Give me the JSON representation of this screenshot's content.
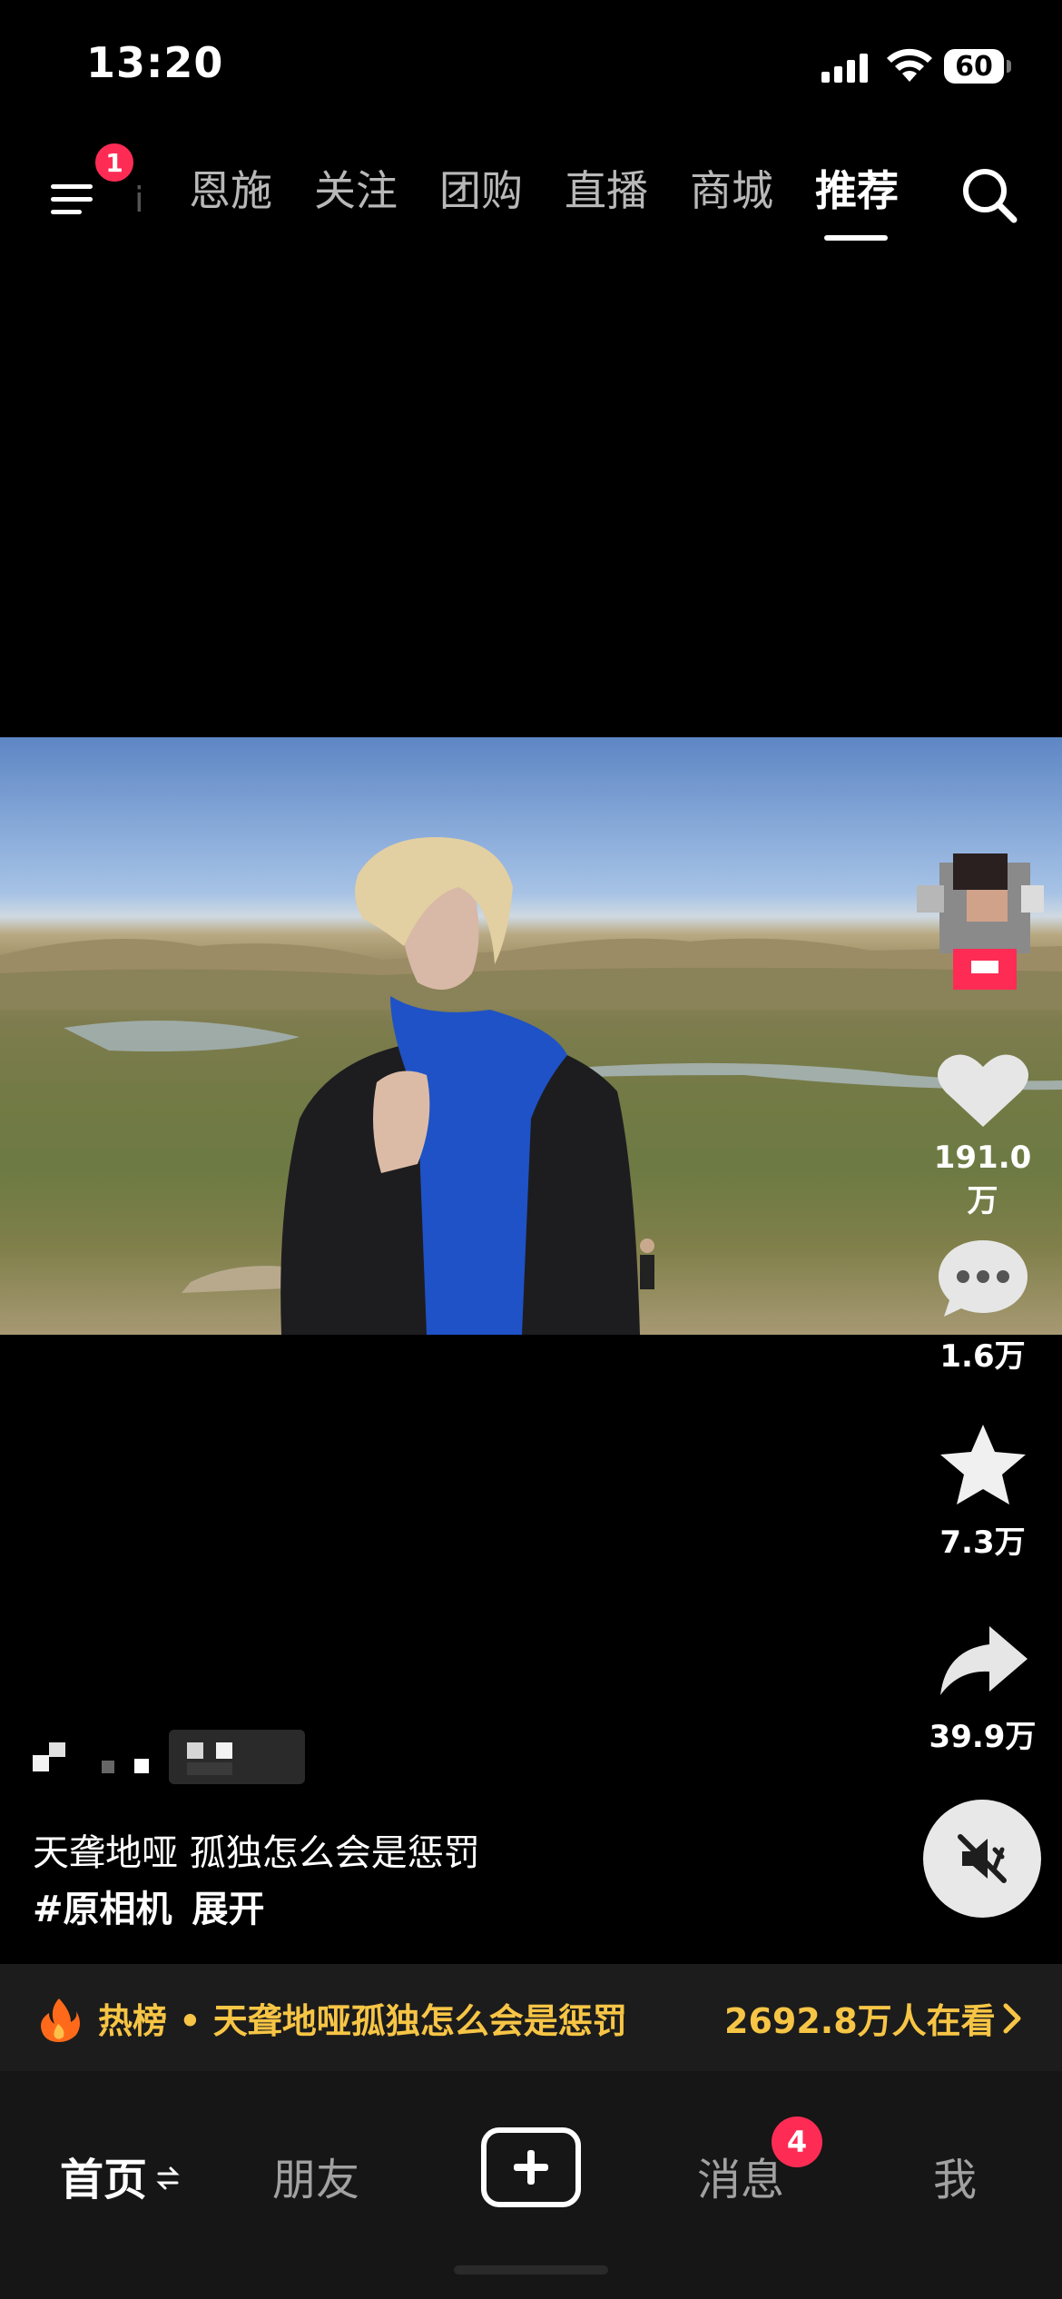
{
  "status_bar": {
    "time": "13:20",
    "battery": "60"
  },
  "top_nav": {
    "menu_badge": "1",
    "partial_tab": "i",
    "tabs": [
      "恩施",
      "关注",
      "团购",
      "直播",
      "商城",
      "推荐"
    ],
    "active_tab": "推荐"
  },
  "sidebar": {
    "likes": "191.0万",
    "comments": "1.6万",
    "favorites": "7.3万",
    "shares": "39.9万"
  },
  "caption": {
    "text": "天聋地哑 孤独怎么会是惩罚",
    "hashtag": "#原相机",
    "expand": "展开"
  },
  "hot_bar": {
    "text": "热榜 • 天聋地哑孤独怎么会是惩罚",
    "watching": "2692.8万人在看"
  },
  "bottom_tabs": {
    "home": "首页",
    "friends": "朋友",
    "messages": "消息",
    "messages_badge": "4",
    "me": "我"
  },
  "colors": {
    "accent": "#fe2c55",
    "hot_text": "#f7c545",
    "background": "#000000"
  }
}
